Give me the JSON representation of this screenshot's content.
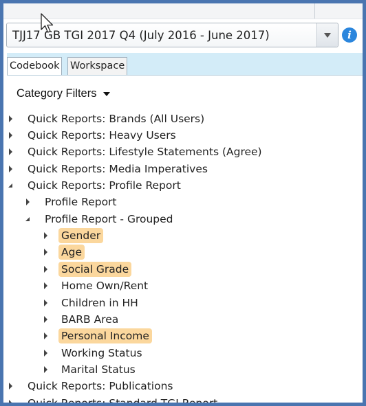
{
  "dataset_select": {
    "value": "TJJ17 GB TGI 2017 Q4 (July 2016 - June 2017)"
  },
  "info_icon": {
    "glyph": "i"
  },
  "tabs": [
    {
      "label": "Codebook",
      "active": true
    },
    {
      "label": "Workspace",
      "active": false
    }
  ],
  "category_filters": {
    "label": "Category Filters"
  },
  "tree": {
    "quick_brands": "Quick Reports: Brands (All Users)",
    "quick_heavy": "Quick Reports: Heavy Users",
    "quick_lifestyle": "Quick Reports: Lifestyle Statements (Agree)",
    "quick_media": "Quick Reports: Media Imperatives",
    "quick_profile": "Quick Reports: Profile Report",
    "profile_report": "Profile Report",
    "profile_grouped": "Profile Report - Grouped",
    "gender": "Gender",
    "age": "Age",
    "social_grade": "Social Grade",
    "home_own": "Home Own/Rent",
    "children": "Children in HH",
    "barb": "BARB Area",
    "personal_income": "Personal Income",
    "working_status": "Working Status",
    "marital_status": "Marital Status",
    "quick_publications": "Quick Reports: Publications",
    "quick_standard": "Quick Reports: Standard TGI Report"
  },
  "highlight_color": "#fbd79d",
  "accent_color": "#4a75b0"
}
